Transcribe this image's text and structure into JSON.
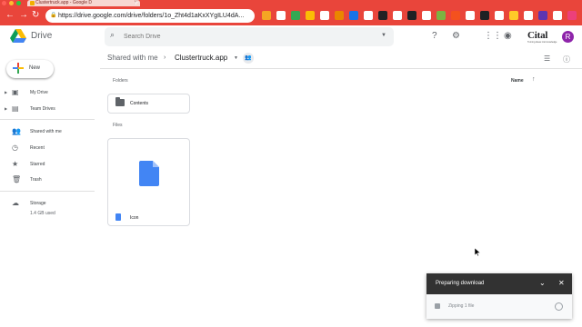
{
  "browser": {
    "tab_title": "Clustertruck.app - Google D",
    "url": "https://drive.google.com/drive/folders/1o_Zht4d1aKxXYgILU4dA...",
    "accent_color": "#e9453b"
  },
  "header": {
    "app_name": "Drive",
    "search_placeholder": "Search Drive",
    "brand_text": "Cital",
    "brand_tagline": "Turning ideas into knowledge",
    "avatar_initial": "R",
    "icons": [
      "help-icon",
      "settings-icon",
      "apps-icon",
      "notifications-icon"
    ]
  },
  "sidebar": {
    "new_label": "New",
    "items": [
      {
        "label": "My Drive",
        "icon": "drive-icon"
      },
      {
        "label": "Team Drives",
        "icon": "team-drive-icon"
      },
      {
        "label": "Shared with me",
        "icon": "people-icon"
      },
      {
        "label": "Recent",
        "icon": "clock-icon"
      },
      {
        "label": "Starred",
        "icon": "star-icon"
      },
      {
        "label": "Trash",
        "icon": "trash-icon"
      },
      {
        "label": "Storage",
        "icon": "cloud-icon"
      }
    ],
    "storage_used": "1.4 GB used"
  },
  "main": {
    "breadcrumb": [
      "Shared with me",
      "Clustertruck.app"
    ],
    "folders_heading": "Folders",
    "files_heading": "Files",
    "sort_label": "Name",
    "folders": [
      {
        "name": "Contents"
      }
    ],
    "files": [
      {
        "name": "Icon"
      }
    ]
  },
  "download": {
    "title": "Preparing download",
    "status": "Zipping 1 file"
  }
}
